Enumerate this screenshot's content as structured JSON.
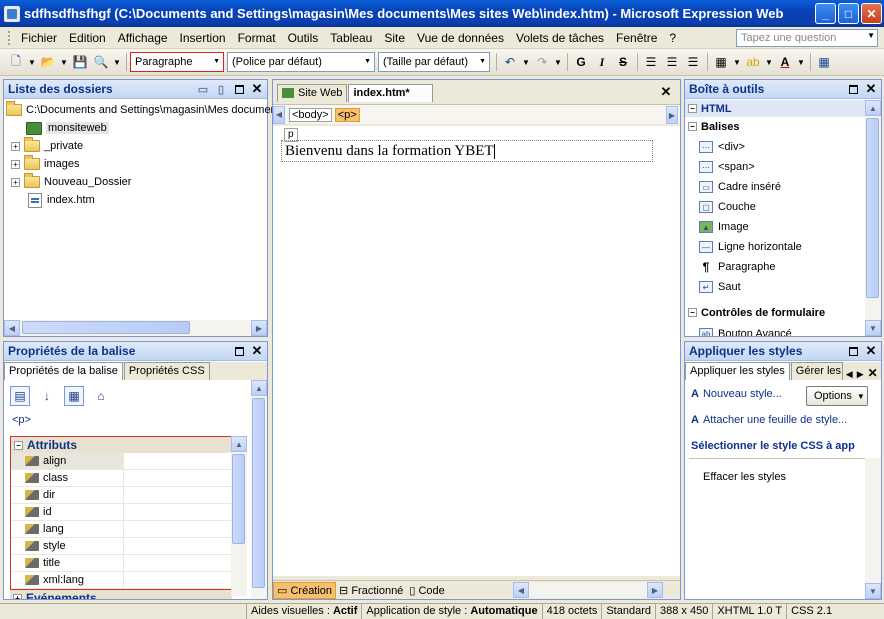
{
  "window": {
    "title": "sdfhsdfhsfhgf (C:\\Documents and Settings\\magasin\\Mes documents\\Mes sites Web\\index.htm) - Microsoft Expression Web",
    "minimize": "_",
    "maximize": "□",
    "close": "✕"
  },
  "menu": {
    "items": [
      "Fichier",
      "Edition",
      "Affichage",
      "Insertion",
      "Format",
      "Outils",
      "Tableau",
      "Site",
      "Vue de données",
      "Volets de tâches",
      "Fenêtre",
      "?"
    ],
    "help_placeholder": "Tapez une question"
  },
  "toolbar": {
    "style_select": "Paragraphe",
    "font_select": "(Police par défaut)",
    "size_select": "(Taille par défaut)",
    "bold": "G",
    "italic": "I",
    "strike": "S"
  },
  "folder_panel": {
    "title": "Liste des dossiers",
    "root": "C:\\Documents and Settings\\magasin\\Mes documents",
    "items": [
      {
        "label": "monsiteweb"
      },
      {
        "label": "_private"
      },
      {
        "label": "images"
      },
      {
        "label": "Nouveau_Dossier"
      },
      {
        "label": "index.htm"
      }
    ]
  },
  "tag_props_panel": {
    "title": "Propriétés de la balise",
    "tabs": [
      "Propriétés de la balise",
      "Propriétés CSS"
    ],
    "current_tag": "<p>",
    "group_attributes": "Attributs",
    "attributes": [
      "align",
      "class",
      "dir",
      "id",
      "lang",
      "style",
      "title",
      "xml:lang"
    ],
    "group_events": "Evénements"
  },
  "editor": {
    "tabs": [
      "Site Web",
      "index.htm*"
    ],
    "breadcrumb": [
      "<body>",
      "<p>"
    ],
    "p_label": "p",
    "content": "Bienvenu dans la formation YBET",
    "view_tabs": [
      "Création",
      "Fractionné",
      "Code"
    ]
  },
  "toolbox": {
    "title": "Boîte à outils",
    "section_html": "HTML",
    "section_tags": "Balises",
    "tags": [
      "<div>",
      "<span>",
      "Cadre inséré",
      "Couche",
      "Image",
      "Ligne horizontale",
      "Paragraphe",
      "Saut"
    ],
    "section_forms": "Contrôles de formulaire",
    "form_first": "Bouton Avancé"
  },
  "styles_panel": {
    "title": "Appliquer les styles",
    "tabs": [
      "Appliquer les styles",
      "Gérer les"
    ],
    "new_style": "Nouveau style...",
    "options": "Options",
    "attach": "Attacher une feuille de style...",
    "select_label": "Sélectionner le style CSS à app",
    "clear": "Effacer les styles"
  },
  "status": {
    "visual_aids_label": "Aides visuelles :",
    "visual_aids_value": "Actif",
    "style_app_label": "Application de style :",
    "style_app_value": "Automatique",
    "size": "418 octets",
    "mode": "Standard",
    "dims": "388 x 450",
    "doctype": "XHTML 1.0 T",
    "css": "CSS 2.1"
  }
}
